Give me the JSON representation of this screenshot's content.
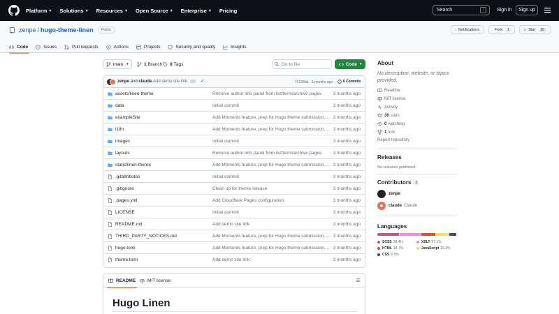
{
  "topnav": {
    "items": [
      "Platform",
      "Solutions",
      "Resources",
      "Open Source",
      "Enterprise",
      "Pricing"
    ],
    "search_label": "Search",
    "search_shortcut": "/",
    "signin": "Sign in",
    "signup": "Sign up"
  },
  "repo": {
    "owner": "zenpe",
    "separator": "/",
    "name": "hugo-theme-linen",
    "visibility": "Public",
    "notifications": "Notifications",
    "fork_label": "Fork",
    "fork_count": "1",
    "star_label": "Star",
    "star_count": "30"
  },
  "tabs": [
    {
      "label": "Code",
      "active": true
    },
    {
      "label": "Issues"
    },
    {
      "label": "Pull requests"
    },
    {
      "label": "Actions"
    },
    {
      "label": "Projects"
    },
    {
      "label": "Security and quality"
    },
    {
      "label": "Insights"
    }
  ],
  "toolbar": {
    "branch": "main",
    "branches_count": "1",
    "branches_label": "Branch",
    "tags_count": "0",
    "tags_label": "Tags",
    "goto_placeholder": "Go to file",
    "code_button": "Code"
  },
  "latest_commit": {
    "author1": "zenpe",
    "and": "and",
    "author2": "claude",
    "message": "Add demo site link",
    "sha_time": "74128da · 3 months ago",
    "commits": "6 Commits"
  },
  "files": [
    {
      "type": "dir",
      "name": "assets/linen-theme",
      "message": "Remove author info panel from list/term/archive pages",
      "time": "3 months ago"
    },
    {
      "type": "dir",
      "name": "data",
      "message": "Initial commit",
      "time": "3 months ago"
    },
    {
      "type": "dir",
      "name": "exampleSite",
      "message": "Add Moments feature, prep for Hugo theme submission, imp...",
      "time": "3 months ago"
    },
    {
      "type": "dir",
      "name": "i18n",
      "message": "Add Moments feature, prep for Hugo theme submission, imp...",
      "time": "3 months ago"
    },
    {
      "type": "dir",
      "name": "images",
      "message": "Initial commit",
      "time": "3 months ago"
    },
    {
      "type": "dir",
      "name": "layouts",
      "message": "Remove author info panel from list/term/archive pages",
      "time": "3 months ago"
    },
    {
      "type": "dir",
      "name": "static/linen-theme",
      "message": "Add Moments feature, prep for Hugo theme submission, imp...",
      "time": "3 months ago"
    },
    {
      "type": "file",
      "name": ".gitattributes",
      "message": "Initial commit",
      "time": "3 months ago"
    },
    {
      "type": "file",
      "name": ".gitignore",
      "message": "Clean up for theme release",
      "time": "3 months ago"
    },
    {
      "type": "file",
      "name": ".pages.yml",
      "message": "Add Cloudflare Pages configuration",
      "time": "3 months ago"
    },
    {
      "type": "file",
      "name": "LICENSE",
      "message": "Initial commit",
      "time": "3 months ago"
    },
    {
      "type": "file",
      "name": "README.md",
      "message": "Add demo site link",
      "time": "3 months ago"
    },
    {
      "type": "file",
      "name": "THIRD_PARTY_NOTICES.md",
      "message": "Add Moments feature, prep for Hugo theme submission, imp...",
      "time": "3 months ago"
    },
    {
      "type": "file",
      "name": "hugo.toml",
      "message": "Add Moments feature, prep for Hugo theme submission, imp...",
      "time": "3 months ago"
    },
    {
      "type": "file",
      "name": "theme.toml",
      "message": "Add demo site link",
      "time": "3 months ago"
    }
  ],
  "readme": {
    "tab_readme": "README",
    "tab_license": "MIT license",
    "heading": "Hugo Linen"
  },
  "about": {
    "title": "About",
    "description": "No description, website, or topics provided.",
    "readme": "Readme",
    "license": "MIT license",
    "activity": "Activity",
    "stars_count": "30",
    "stars_label": "stars",
    "watching_count": "0",
    "watching_label": "watching",
    "forks_count": "1",
    "forks_label": "fork",
    "report": "Report repository"
  },
  "releases": {
    "title": "Releases",
    "empty": "No releases published"
  },
  "contributors": {
    "title": "Contributors",
    "count": "2",
    "list": [
      {
        "login": "zenpe",
        "name": ""
      },
      {
        "login": "claude",
        "name": "Claude"
      }
    ]
  },
  "languages": {
    "title": "Languages",
    "items": [
      {
        "name": "SCSS",
        "percent": "28.4%",
        "value": 28.4,
        "color": "#c6538c"
      },
      {
        "name": "XSLT",
        "percent": "27.1%",
        "value": 27.1,
        "color": "#eb8ceb"
      },
      {
        "name": "HTML",
        "percent": "18.7%",
        "value": 18.7,
        "color": "#e34c26"
      },
      {
        "name": "JavaScript",
        "percent": "16.3%",
        "value": 16.3,
        "color": "#f1e05a"
      },
      {
        "name": "CSS",
        "percent": "9.5%",
        "value": 9.5,
        "color": "#563d7c"
      }
    ]
  }
}
